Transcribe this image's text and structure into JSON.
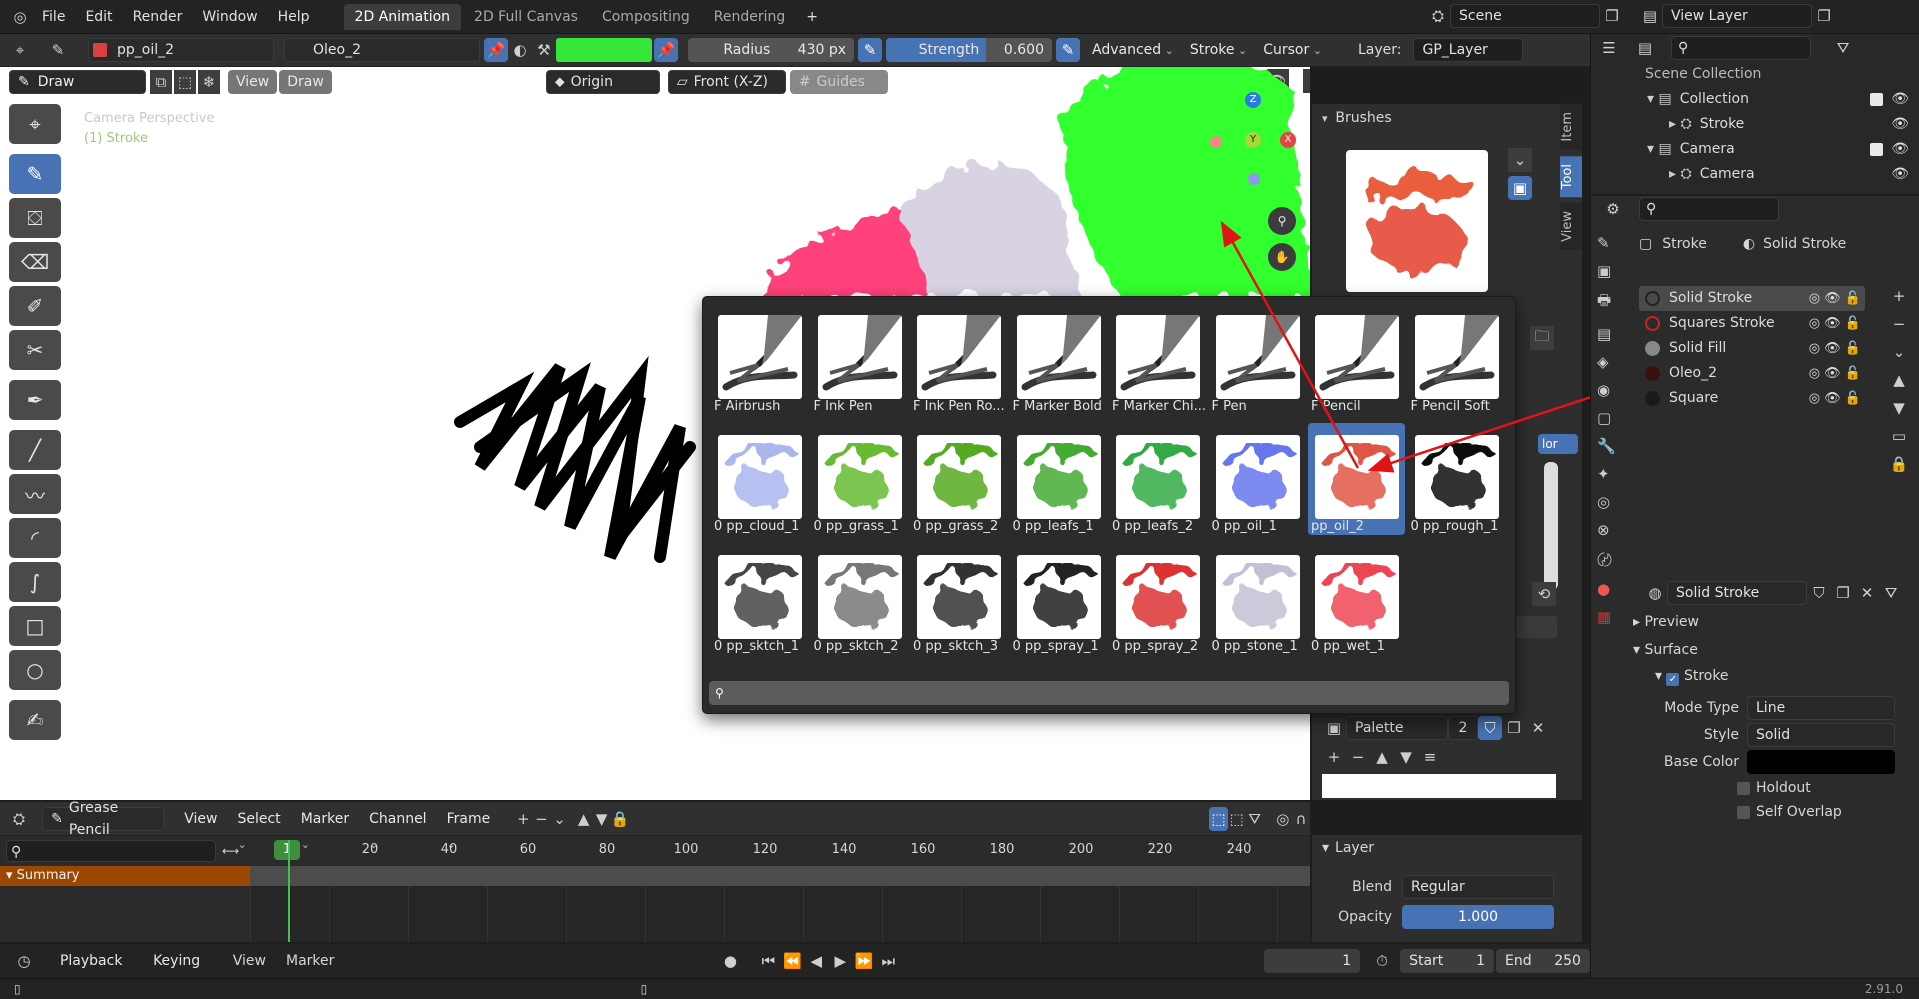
{
  "menubar": {
    "items": [
      "File",
      "Edit",
      "Render",
      "Window",
      "Help"
    ],
    "workspaces": [
      {
        "label": "2D Animation",
        "active": true
      },
      {
        "label": "2D Full Canvas",
        "active": false
      },
      {
        "label": "Compositing",
        "active": false
      },
      {
        "label": "Rendering",
        "active": false
      }
    ],
    "add_tab": "+",
    "scene": "Scene",
    "view_layer": "View Layer"
  },
  "tool_header": {
    "brush_name": "pp_oil_2",
    "material": "Oleo_2",
    "color_hex": "#36e63a",
    "radius_label": "Radius",
    "radius_value": "430 px",
    "strength_label": "Strength",
    "strength_value": "0.600",
    "advanced": "Advanced",
    "stroke": "Stroke",
    "cursor": "Cursor",
    "layer_label": "Layer:",
    "layer_value": "GP_Layer"
  },
  "view_header": {
    "mode": "Draw",
    "view": "View",
    "draw": "Draw",
    "origin": "Origin",
    "front": "Front (X-Z)",
    "guides": "Guides"
  },
  "viewport": {
    "camera_text": "Camera Perspective",
    "object_text": "(1) Stroke",
    "gizmo": {
      "z": "Z",
      "y": "Y",
      "x": "X"
    }
  },
  "brush_popup": {
    "brushes": [
      {
        "label": "F Airbrush",
        "style": "pen"
      },
      {
        "label": "F Ink Pen",
        "style": "pen"
      },
      {
        "label": "F Ink Pen Ro...",
        "style": "pen"
      },
      {
        "label": "F Marker Bold",
        "style": "pen"
      },
      {
        "label": "F Marker Chi...",
        "style": "pen"
      },
      {
        "label": "F Pen",
        "style": "pen"
      },
      {
        "label": "F Pencil",
        "style": "pen"
      },
      {
        "label": "F Pencil Soft",
        "style": "pen"
      },
      {
        "label": "0 pp_cloud_1",
        "style": "#aab6ee"
      },
      {
        "label": "0 pp_grass_1",
        "style": "#66bb33"
      },
      {
        "label": "0 pp_grass_2",
        "style": "#55aa22"
      },
      {
        "label": "0 pp_leafs_1",
        "style": "#44aa33"
      },
      {
        "label": "0 pp_leafs_2",
        "style": "#33aa44"
      },
      {
        "label": "0 pp_oil_1",
        "style": "#6677ee"
      },
      {
        "label": "pp_oil_2",
        "style": "#e05545"
      },
      {
        "label": "0 pp_rough_1",
        "style": "#111111"
      },
      {
        "label": "0 pp_sktch_1",
        "style": "#444444"
      },
      {
        "label": "0 pp_sktch_2",
        "style": "#777777"
      },
      {
        "label": "0 pp_sktch_3",
        "style": "#333333"
      },
      {
        "label": "0 pp_spray_1",
        "style": "#222222"
      },
      {
        "label": "0 pp_spray_2",
        "style": "#dd3333"
      },
      {
        "label": "0 pp_stone_1",
        "style": "#c4bfd4"
      },
      {
        "label": "0 pp_wet_1",
        "style": "#ee4455"
      }
    ],
    "selected_index": 14
  },
  "npanel": {
    "tabs": [
      "Item",
      "Tool",
      "View"
    ],
    "brushes_title": "Brushes",
    "color_btn": "lor",
    "stroke_field": "Stroke",
    "palette_label": "Palette",
    "palette_count": "2"
  },
  "outliner": {
    "title": "Scene Collection",
    "rows": [
      {
        "label": "Collection",
        "indent": 1,
        "checkbox": true
      },
      {
        "label": "Stroke",
        "indent": 2,
        "checkbox": false
      },
      {
        "label": "Camera",
        "indent": 1,
        "checkbox": true
      },
      {
        "label": "Camera",
        "indent": 2,
        "checkbox": false
      }
    ]
  },
  "properties": {
    "breadcrumb_obj": "Stroke",
    "breadcrumb_mat": "Solid Stroke",
    "materials": [
      {
        "label": "Solid Stroke",
        "color": "#222222",
        "ring": true,
        "selected": true
      },
      {
        "label": "Squares Stroke",
        "color": "#cc2222",
        "ring": true,
        "selected": false
      },
      {
        "label": "Solid Fill",
        "color": "#888888",
        "ring": false,
        "selected": false
      },
      {
        "label": "Oleo_2",
        "color": "#3a1010",
        "ring": false,
        "selected": false
      },
      {
        "label": "Square",
        "color": "#1a1a1a",
        "ring": false,
        "selected": false
      }
    ],
    "slot_name": "Solid Stroke",
    "preview": "Preview",
    "surface": "Surface",
    "stroke_section": "Stroke",
    "mode_type_label": "Mode Type",
    "mode_type_value": "Line",
    "style_label": "Style",
    "style_value": "Solid",
    "base_color_label": "Base Color",
    "holdout": "Holdout",
    "self_overlap": "Self Overlap"
  },
  "timeline": {
    "editor": "Grease Pencil",
    "menus": [
      "View",
      "Select",
      "Marker",
      "Channel",
      "Frame"
    ],
    "frame_labels": [
      "20",
      "40",
      "60",
      "80",
      "100",
      "120",
      "140",
      "160",
      "180",
      "200",
      "220",
      "240"
    ],
    "current_frame_label": "1",
    "summary": "Summary"
  },
  "layer_panel": {
    "title": "Layer",
    "blend_label": "Blend",
    "blend_value": "Regular",
    "opacity_label": "Opacity",
    "opacity_value": "1.000"
  },
  "playback": {
    "playback": "Playback",
    "keying": "Keying",
    "view": "View",
    "marker": "Marker",
    "current": "1",
    "start_label": "Start",
    "start_value": "1",
    "end_label": "End",
    "end_value": "250"
  },
  "status": {
    "version": "2.91.0"
  }
}
